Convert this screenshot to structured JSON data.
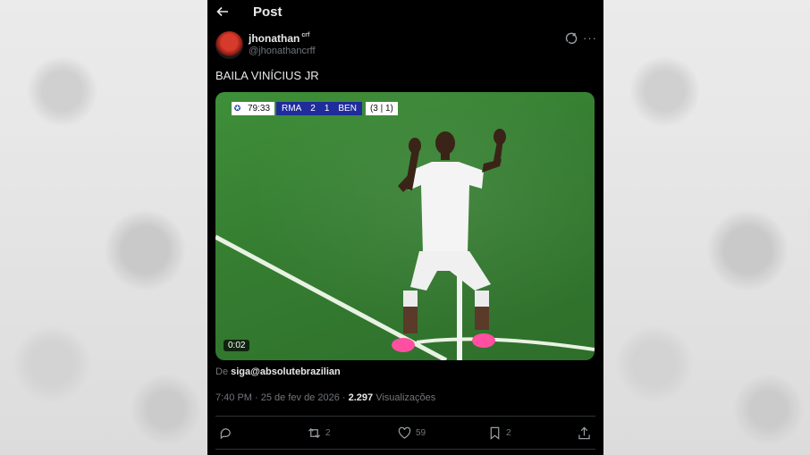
{
  "header": {
    "title": "Post"
  },
  "post": {
    "display_name": "jhonathan",
    "name_badge": "crf",
    "handle": "@jhonathancrff",
    "text": "BAILA VINÍCIUS JR",
    "via_prefix": "De",
    "via_account": "siga@absolutebrazilian",
    "time": "7:40 PM",
    "date": "25 de fev de 2026",
    "views_count": "2.297",
    "views_label": "Visualizações"
  },
  "video": {
    "clock": "79:33",
    "home": "RMA",
    "home_score": "2",
    "away_score": "1",
    "away": "BEN",
    "aggregate": "(3 | 1)",
    "duration": "0:02"
  },
  "actions": {
    "replies": "",
    "reposts": "2",
    "likes": "59",
    "bookmarks": "2"
  },
  "icons": [
    "back-arrow-icon",
    "grok-icon",
    "more-icon",
    "reply-icon",
    "repost-icon",
    "like-icon",
    "bookmark-icon",
    "share-icon"
  ],
  "colors": {
    "background": "#000000",
    "muted": "#71767b",
    "text": "#e7e9ea",
    "scoreboard": "#1f2c9a"
  }
}
